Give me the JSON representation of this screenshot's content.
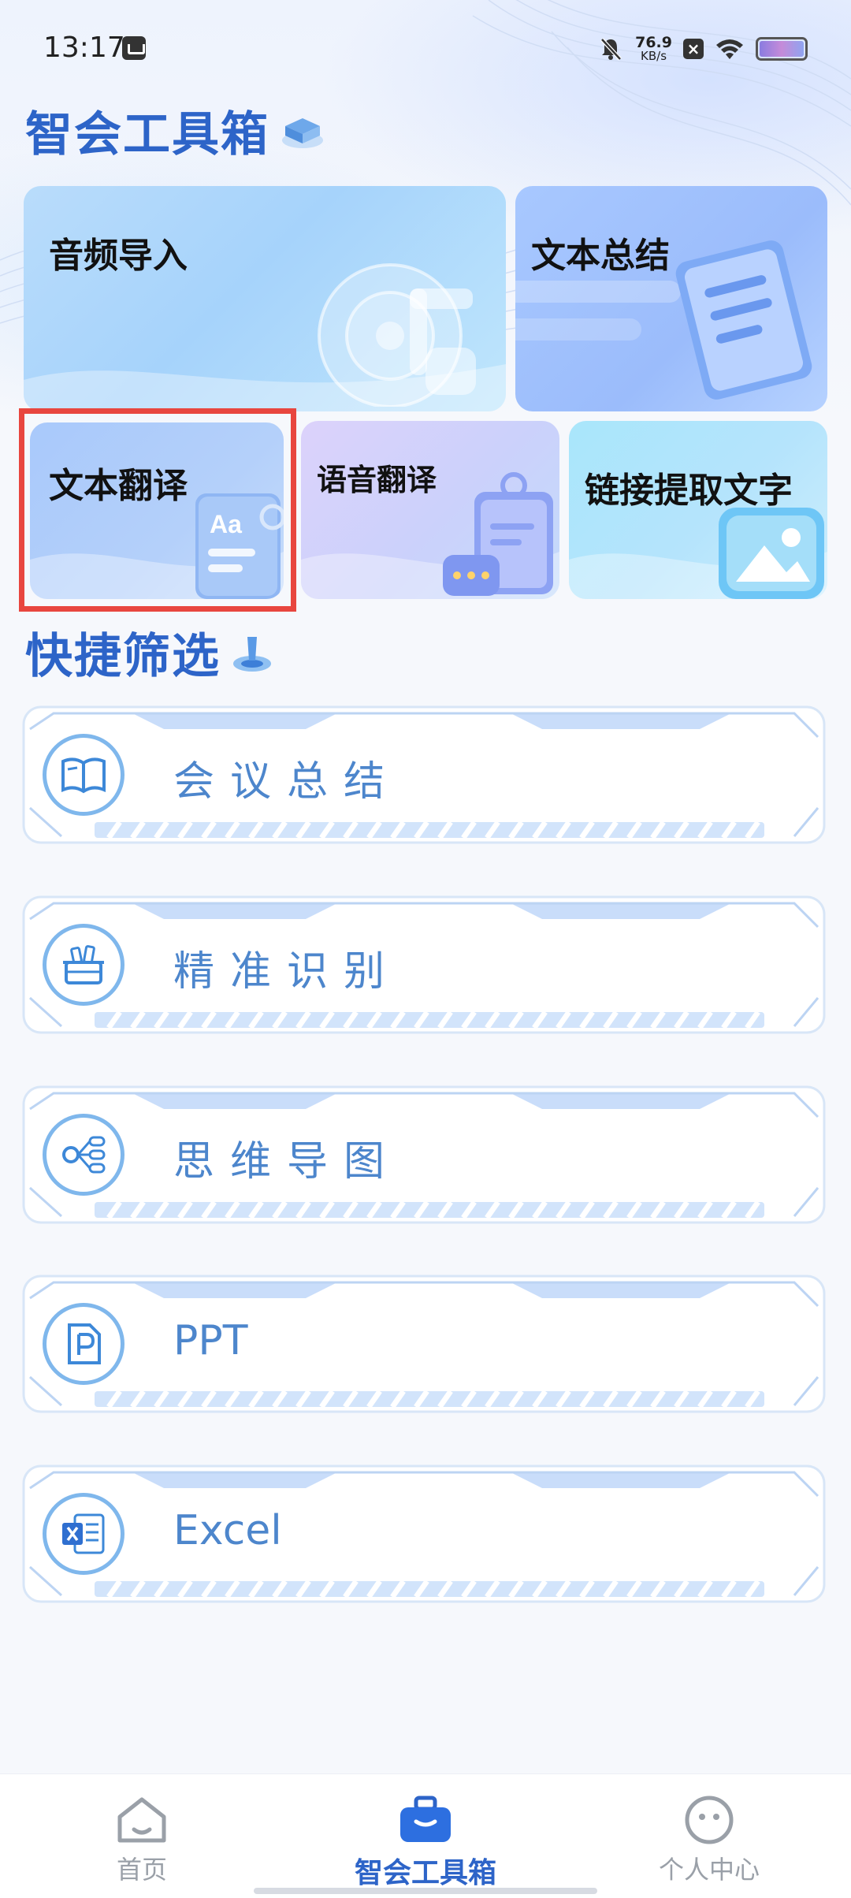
{
  "status_bar": {
    "time": "13:17",
    "net_speed_value": "76.9",
    "net_speed_unit": "KB/s"
  },
  "page": {
    "title": "智会工具箱",
    "section_quick": "快捷筛选"
  },
  "tools": {
    "audio_import": "音频导入",
    "text_summary": "文本总结",
    "text_translate": "文本翻译",
    "voice_translate": "语音翻译",
    "link_extract": "链接提取文字"
  },
  "filters": [
    {
      "label": "会议总结",
      "icon": "book-icon"
    },
    {
      "label": "精准识别",
      "icon": "basket-icon"
    },
    {
      "label": "思维导图",
      "icon": "mindmap-icon"
    },
    {
      "label": "PPT",
      "icon": "ppt-file-icon"
    },
    {
      "label": "Excel",
      "icon": "excel-file-icon"
    }
  ],
  "bottom_nav": {
    "home": "首页",
    "tools": "智会工具箱",
    "profile": "个人中心",
    "active": "tools"
  },
  "colors": {
    "accent": "#2d64c8",
    "filter_text": "#4d86cc",
    "highlight": "#e8463f"
  }
}
